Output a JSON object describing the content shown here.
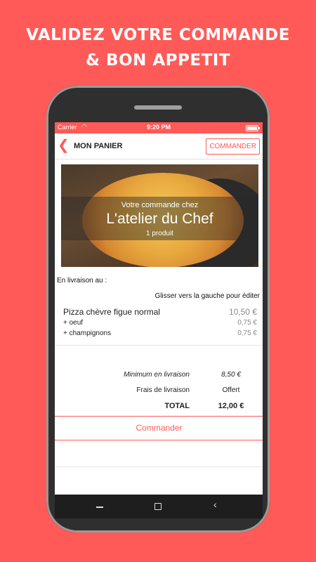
{
  "promo": {
    "line1": "VALIDEZ VOTRE COMMANDE",
    "line2": "& BON APPETIT"
  },
  "status": {
    "carrier": "Carrier",
    "time": "9:20 PM"
  },
  "nav": {
    "title": "MON PANIER",
    "order_button": "COMMANDER"
  },
  "hero": {
    "subtitle": "Votre commande chez",
    "restaurant": "L'atelier du Chef",
    "count": "1 produit"
  },
  "delivery_label": "En livraison au :",
  "swipe_hint": "Glisser vers la gauche pour éditer",
  "items": [
    {
      "name": "Pizza chèvre figue normal",
      "price": "10,50 €"
    },
    {
      "name": "+ oeuf",
      "price": "0,75 €"
    },
    {
      "name": "+ champignons",
      "price": "0,75 €"
    }
  ],
  "summary": {
    "min_label": "Minimum en livraison",
    "min_value": "8,50 €",
    "fees_label": "Frais de livraison",
    "fees_value": "Offert",
    "total_label": "TOTAL",
    "total_value": "12,00 €"
  },
  "order_cta": "Commander",
  "colors": {
    "accent": "#ff5a57"
  },
  "icons": {
    "back": "chevron-left-icon",
    "wifi": "wifi-icon",
    "battery": "battery-icon"
  }
}
